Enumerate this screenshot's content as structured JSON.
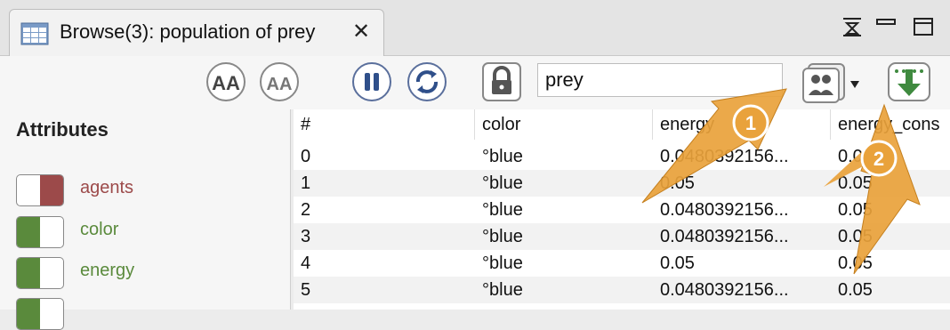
{
  "tab": {
    "title": "Browse(3): population of prey",
    "close_icon": "close-icon"
  },
  "window_buttons": [
    "presentation-icon",
    "minimize-icon",
    "maximize-icon"
  ],
  "toolbar": {
    "search_value": "prey",
    "buttons": [
      "font-increase-icon",
      "font-decrease-icon",
      "pause-icon",
      "refresh-icon",
      "lock-icon",
      "population-icon",
      "export-icon"
    ]
  },
  "attributes": {
    "title": "Attributes",
    "items": [
      {
        "label": "agents",
        "color": "#9c4a4a"
      },
      {
        "label": "color",
        "color": "#5a8a3c"
      },
      {
        "label": "energy",
        "color": "#5a8a3c"
      }
    ]
  },
  "table": {
    "headers": [
      "#",
      "color",
      "energy",
      "energy_cons"
    ],
    "rows": [
      [
        "0",
        "°blue",
        "0.0480392156...",
        "0.05"
      ],
      [
        "1",
        "°blue",
        "0.05",
        "0.05"
      ],
      [
        "2",
        "°blue",
        "0.0480392156...",
        "0.05"
      ],
      [
        "3",
        "°blue",
        "0.0480392156...",
        "0.05"
      ],
      [
        "4",
        "°blue",
        "0.05",
        "0.05"
      ],
      [
        "5",
        "°blue",
        "0.0480392156...",
        "0.05"
      ]
    ]
  },
  "callouts": [
    {
      "number": "1",
      "color": "#e9a23b"
    },
    {
      "number": "2",
      "color": "#e9a23b"
    }
  ]
}
